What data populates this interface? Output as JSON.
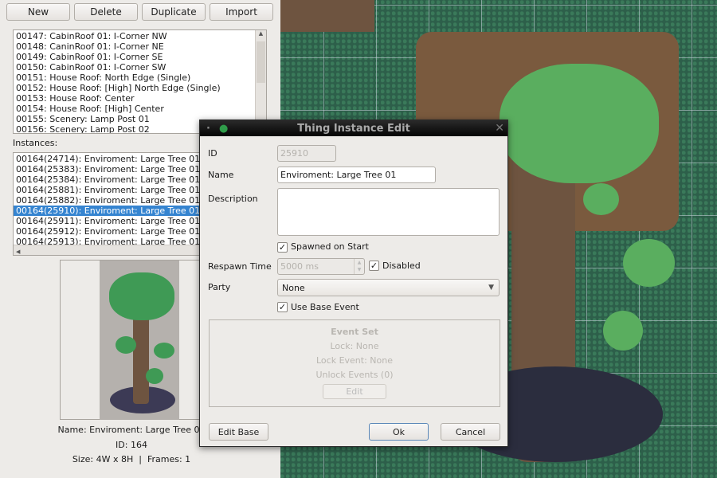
{
  "toolbar": {
    "new": "New",
    "delete": "Delete",
    "duplicate": "Duplicate",
    "import": "Import"
  },
  "things": [
    "00147: CabinRoof 01: I-Corner NW",
    "00148: CaninRoof 01: I-Corner NE",
    "00149: CabinRoof 01: I-Corner SE",
    "00150: CabinRoof 01: I-Corner SW",
    "00151: House Roof: North Edge (Single)",
    "00152: House Roof: [High] North Edge (Single)",
    "00153: House Roof: Center",
    "00154: House Roof: [High] Center",
    "00155: Scenery: Lamp Post 01",
    "00156: Scenery: Lamp Post 02"
  ],
  "instances_label": "Instances:",
  "instances": [
    "00164(24714): Enviroment: Large Tree 01",
    "00164(25383): Enviroment: Large Tree 01",
    "00164(25384): Enviroment: Large Tree 01",
    "00164(25881): Enviroment: Large Tree 01",
    "00164(25882): Enviroment: Large Tree 01",
    "00164(25910): Enviroment: Large Tree 01",
    "00164(25911): Enviroment: Large Tree 01",
    "00164(25912): Enviroment: Large Tree 01",
    "00164(25913): Enviroment: Large Tree 01"
  ],
  "selected_instance_index": 5,
  "preview": {
    "name": "Name: Enviroment: Large Tree 01",
    "id": "ID: 164",
    "size": "Size: 4W x 8H  |  Frames: 1"
  },
  "dialog": {
    "title": "Thing Instance Edit",
    "id_label": "ID",
    "id_value": "25910",
    "name_label": "Name",
    "name_value": "Enviroment: Large Tree 01",
    "description_label": "Description",
    "description_value": "",
    "spawned_label": "Spawned on Start",
    "spawned_checked": true,
    "respawn_label": "Respawn Time",
    "respawn_value": "5000 ms",
    "disabled_label": "Disabled",
    "disabled_checked": true,
    "party_label": "Party",
    "party_value": "None",
    "use_base_label": "Use Base Event",
    "use_base_checked": true,
    "event_set": {
      "title": "Event Set",
      "lock": "Lock: None",
      "lock_event": "Lock Event: None",
      "unlock_events": "Unlock Events (0)",
      "edit": "Edit"
    },
    "edit_base": "Edit Base",
    "ok": "Ok",
    "cancel": "Cancel"
  },
  "colors": {
    "selection": "#3584d0",
    "titlebar": "#0a0a0a",
    "map_green": "#2d5f4a",
    "trunk": "#7a5a3e"
  }
}
